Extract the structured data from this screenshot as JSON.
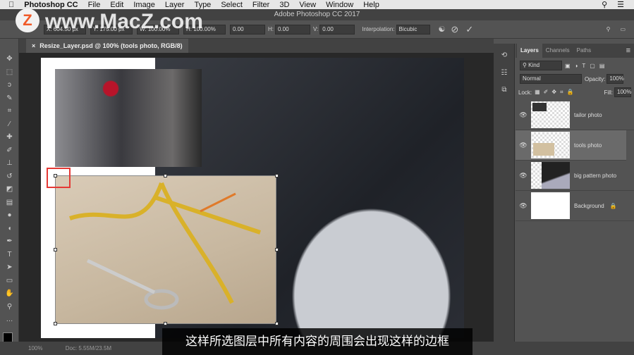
{
  "menubar": {
    "app": "Photoshop CC",
    "items": [
      "File",
      "Edit",
      "Image",
      "Layer",
      "Type",
      "Select",
      "Filter",
      "3D",
      "View",
      "Window",
      "Help"
    ]
  },
  "window_title": "Adobe Photoshop CC 2017",
  "options": {
    "x": "X: 604.50 px",
    "y": "Y: 175.00 px",
    "w": "W: 100.00%",
    "h": "H: 100.00%",
    "angle": "0.00",
    "hskew_label": "H:",
    "hskew": "0.00",
    "vskew_label": "V:",
    "vskew": "0.00",
    "interp_label": "Interpolation:",
    "interp": "Bicubic"
  },
  "doc_tab": "Resize_Layer.psd @ 100% (tools photo, RGB/8)",
  "layers_panel": {
    "tabs": [
      "Layers",
      "Channels",
      "Paths"
    ],
    "filter": "Kind",
    "blend": "Normal",
    "opacity_label": "Opacity:",
    "opacity": "100%",
    "lock_label": "Lock:",
    "fill_label": "Fill:",
    "fill": "100%",
    "layers": [
      {
        "name": "tailor photo"
      },
      {
        "name": "tools photo",
        "selected": true
      },
      {
        "name": "big pattern photo"
      },
      {
        "name": "Background",
        "locked": true
      }
    ]
  },
  "status": {
    "zoom": "100%",
    "doc": "Doc: 5.55M/23.5M"
  },
  "subtitle": "这样所选图层中所有内容的周围会出现这样的边框",
  "watermark": "www.MacZ.com",
  "colors": {
    "selection_highlight": "#e53935"
  }
}
